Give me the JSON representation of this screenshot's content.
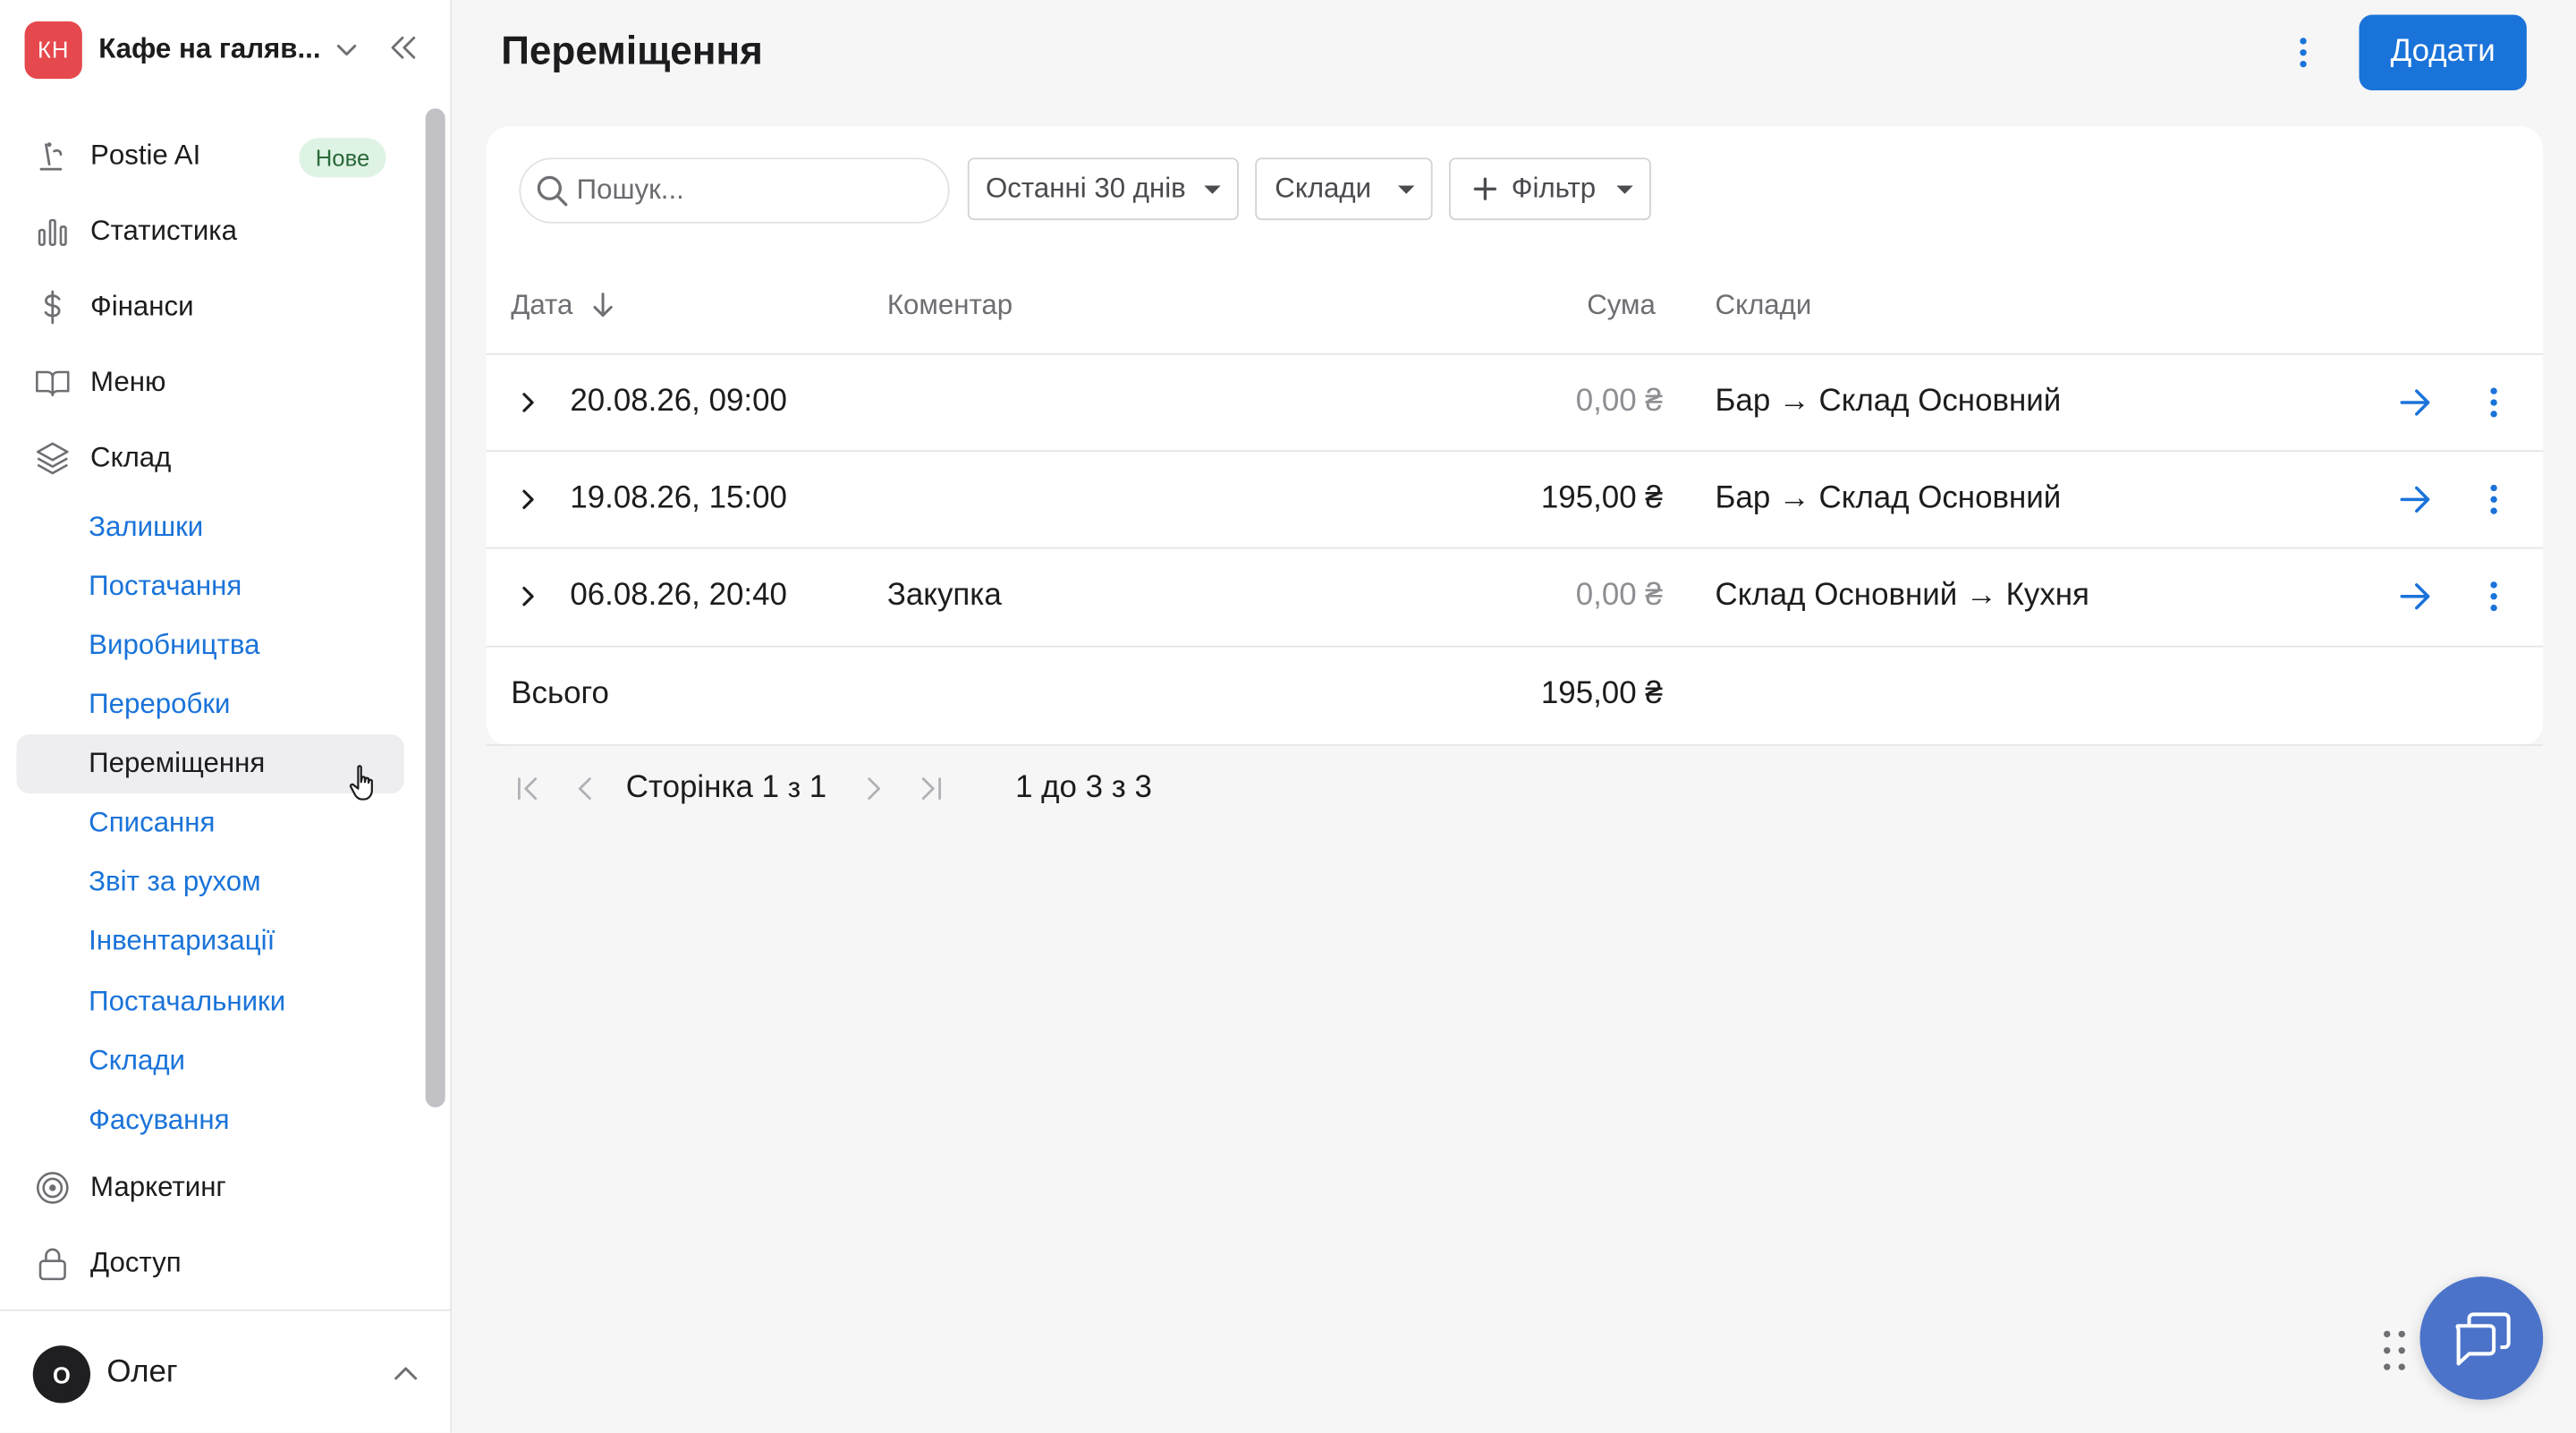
{
  "sidebar": {
    "brand_initials": "КН",
    "brand_name": "Кафе на галяв...",
    "items": [
      {
        "label": "Postie AI",
        "badge": "Нове",
        "icon": "sparkle-icon"
      },
      {
        "label": "Статистика",
        "icon": "bar-chart-icon"
      },
      {
        "label": "Фінанси",
        "icon": "dollar-icon"
      },
      {
        "label": "Меню",
        "icon": "book-icon"
      },
      {
        "label": "Склад",
        "icon": "layers-icon"
      }
    ],
    "sub_items": [
      "Залишки",
      "Постачання",
      "Виробництва",
      "Переробки",
      "Переміщення",
      "Списання",
      "Звіт за рухом",
      "Інвентаризації",
      "Постачальники",
      "Склади",
      "Фасування"
    ],
    "active_sub_item": "Переміщення",
    "items_bottom": [
      {
        "label": "Маркетинг",
        "icon": "target-icon"
      },
      {
        "label": "Доступ",
        "icon": "lock-icon"
      }
    ],
    "user": {
      "initial": "О",
      "name": "Олег"
    }
  },
  "header": {
    "title": "Переміщення",
    "add_label": "Додати"
  },
  "filters": {
    "search_placeholder": "Пошук...",
    "period": "Останні 30 днів",
    "warehouses": "Склади",
    "filter": "Фільтр"
  },
  "table": {
    "columns": {
      "date": "Дата",
      "comment": "Коментар",
      "sum": "Сума",
      "warehouses": "Склади"
    },
    "rows": [
      {
        "date": "20.08.26, 09:00",
        "comment": "",
        "sum": "0,00 ₴",
        "warehouses": "Бар → Склад Основний"
      },
      {
        "date": "19.08.26, 15:00",
        "comment": "",
        "sum": "195,00 ₴",
        "warehouses": "Бар → Склад Основний"
      },
      {
        "date": "06.08.26, 20:40",
        "comment": "Закупка",
        "sum": "0,00 ₴",
        "warehouses": "Склад Основний → Кухня"
      }
    ],
    "total_label": "Всього",
    "total_sum": "195,00 ₴"
  },
  "pagination": {
    "page_prefix": "Сторінка",
    "page_current": "1",
    "page_of": "з",
    "page_total": "1",
    "range_text": "1 до 3 з 3"
  },
  "colors": {
    "accent": "#1a73d9",
    "brand_logo": "#e5484d",
    "chat_button": "#4b73c9"
  }
}
